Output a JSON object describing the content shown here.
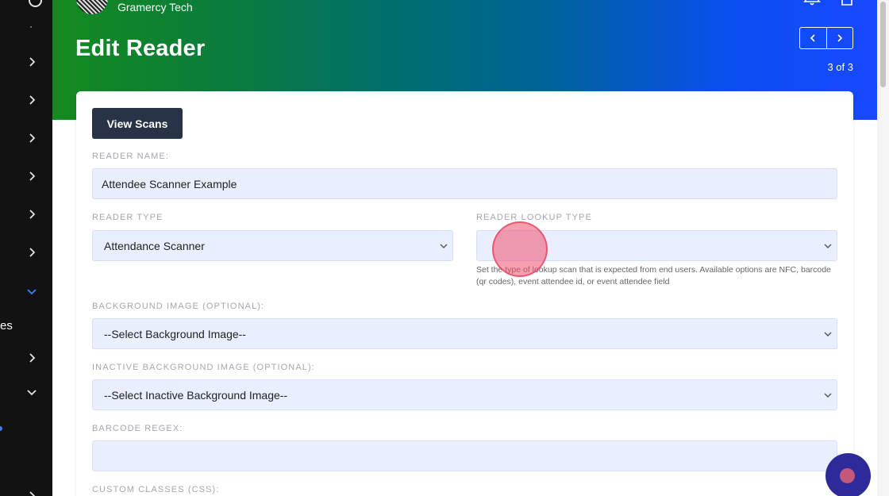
{
  "header": {
    "org_name": "Gramercy Tech",
    "title": "Edit Reader",
    "pagination": "3 of 3"
  },
  "sidebar": {
    "partial_label": "es"
  },
  "actions": {
    "view_scans": "View Scans"
  },
  "form": {
    "reader_name": {
      "label": "READER NAME:",
      "value": "Attendee Scanner Example"
    },
    "reader_type": {
      "label": "READER TYPE",
      "value": "Attendance Scanner"
    },
    "lookup_type": {
      "label": "READER LOOKUP TYPE",
      "value": "",
      "help": "Set the type of lookup scan that is expected from end users. Available options are NFC, barcode (qr codes), event attendee id, or event attendee field"
    },
    "background_image": {
      "label": "BACKGROUND IMAGE (OPTIONAL):",
      "value": "--Select Background Image--"
    },
    "inactive_background_image": {
      "label": "INACTIVE BACKGROUND IMAGE (OPTIONAL):",
      "value": "--Select Inactive Background Image--"
    },
    "barcode_regex": {
      "label": "BARCODE REGEX:",
      "value": ""
    },
    "custom_classes": {
      "label": "CUSTOM CLASSES (CSS):"
    }
  },
  "icons": {
    "bell": "bell-icon",
    "user": "user-icon",
    "prev": "chevron-left-icon",
    "next": "chevron-right-icon",
    "select": "chevron-down-icon"
  },
  "colors": {
    "sidebar_bg": "#121212",
    "banner_start": "#148a1e",
    "banner_end": "#1848ff",
    "button_dark": "#283347",
    "field_bg": "#e9efff",
    "active_accent": "#3b82f6"
  }
}
